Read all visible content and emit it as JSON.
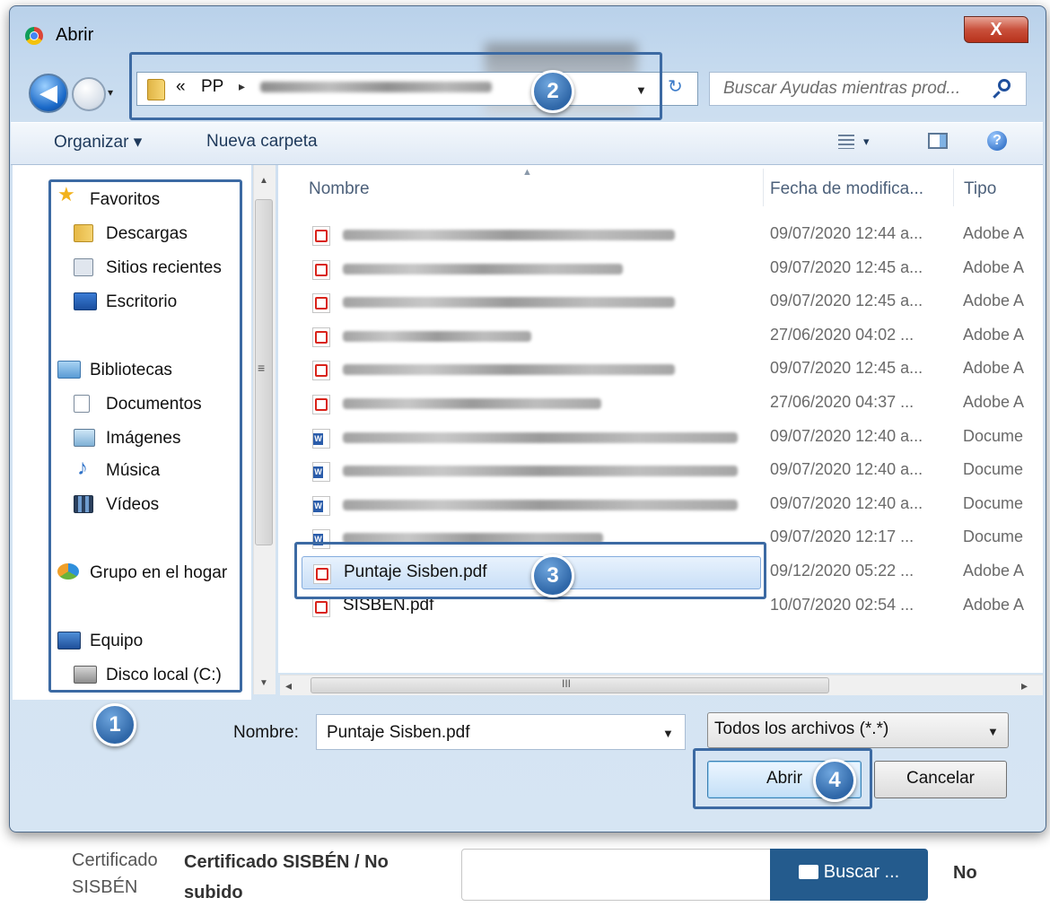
{
  "dialog": {
    "title": "Abrir",
    "close_label": "X",
    "back_label": "◀",
    "nav_dropdown": "▾",
    "address": {
      "chevron": "«",
      "root": "PP",
      "separator": "▸",
      "dropdown": "▼",
      "refresh_label": "↻"
    },
    "search_placeholder": "Buscar Ayudas mientras prod...",
    "toolbar": {
      "organize": "Organizar ▾",
      "new_folder": "Nueva carpeta",
      "views_dropdown": "▾",
      "help_label": "?"
    },
    "nav_pane": {
      "favorites_header": "Favoritos",
      "favorites": [
        "Descargas",
        "Sitios recientes",
        "Escritorio"
      ],
      "libraries_header": "Bibliotecas",
      "libraries": [
        "Documentos",
        "Imágenes",
        "Música",
        "Vídeos"
      ],
      "homegroup": "Grupo en el hogar",
      "computer_header": "Equipo",
      "computer": [
        "Disco local (C:)"
      ],
      "scroll_up": "▲",
      "scroll_down": "▼",
      "scroll_grip": "≡"
    },
    "columns": {
      "name": "Nombre",
      "date": "Fecha de modifica...",
      "type": "Tipo",
      "sort_arrow": "▲"
    },
    "files": [
      {
        "kind": "pdf",
        "date": "09/07/2020 12:44 a...",
        "type": "Adobe A"
      },
      {
        "kind": "pdf",
        "date": "09/07/2020 12:45 a...",
        "type": "Adobe A"
      },
      {
        "kind": "pdf",
        "date": "09/07/2020 12:45 a...",
        "type": "Adobe A"
      },
      {
        "kind": "pdf",
        "date": "27/06/2020 04:02 ...",
        "type": "Adobe A"
      },
      {
        "kind": "pdf",
        "date": "09/07/2020 12:45 a...",
        "type": "Adobe A"
      },
      {
        "kind": "pdf",
        "date": "27/06/2020 04:37 ...",
        "type": "Adobe A"
      },
      {
        "kind": "doc",
        "date": "09/07/2020 12:40 a...",
        "type": "Docume"
      },
      {
        "kind": "doc",
        "date": "09/07/2020 12:40 a...",
        "type": "Docume"
      },
      {
        "kind": "doc",
        "date": "09/07/2020 12:40 a...",
        "type": "Docume"
      },
      {
        "kind": "doc",
        "date": "09/07/2020 12:17 ...",
        "type": "Docume"
      },
      {
        "kind": "pdf",
        "name": "Puntaje Sisben.pdf",
        "date": "09/12/2020 05:22 ...",
        "type": "Adobe A",
        "selected": true
      },
      {
        "kind": "pdf",
        "name": "SISBEN.pdf",
        "date": "10/07/2020 02:54 ...",
        "type": "Adobe A"
      }
    ],
    "hscroll": {
      "left": "◂",
      "grip": "III",
      "right": "▸"
    },
    "filename_label": "Nombre:",
    "filename_value": "Puntaje Sisben.pdf",
    "filename_dropdown": "▼",
    "filter_value": "Todos los archivos (*.*)",
    "filter_dropdown": "▼",
    "open_button": "Abrir",
    "cancel_button": "Cancelar"
  },
  "callouts": [
    "1",
    "2",
    "3",
    "4"
  ],
  "page": {
    "field_label": "Certificado SISBÉN",
    "doc_title": "Certificado SISBÉN / No subido",
    "browse_button": "Buscar ...",
    "status": "No"
  },
  "colors": {
    "callout": "#3c6aa3",
    "selection": "#c9dff7",
    "pdf_icon": "#d9231a",
    "browse_button": "#245b8d"
  }
}
